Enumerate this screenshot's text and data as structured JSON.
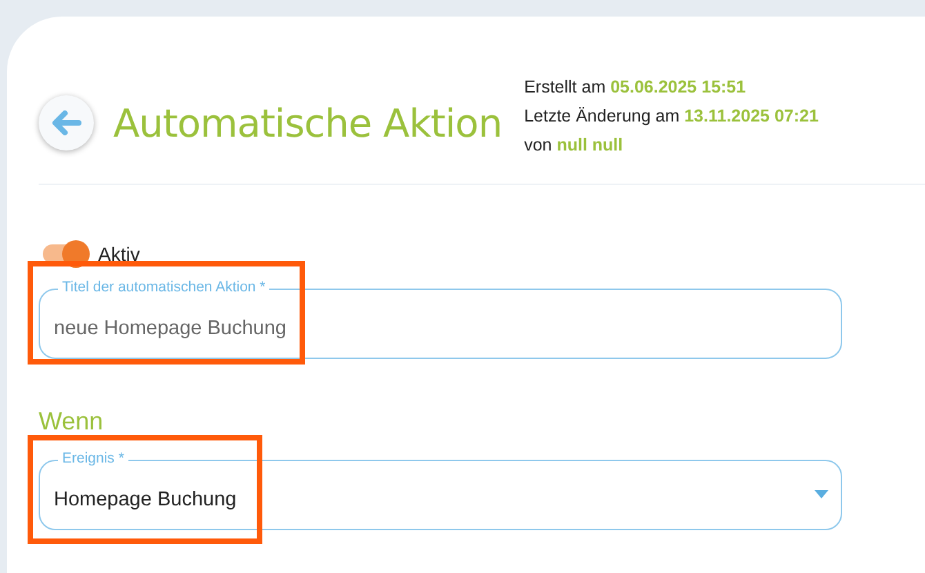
{
  "header": {
    "title": "Automatische Aktion",
    "meta": [
      {
        "label": "Erstellt am",
        "value": "05.06.2025 15:51"
      },
      {
        "label": "Letzte Änderung am",
        "value": "13.11.2025 07:21"
      },
      {
        "label": "von",
        "value": "null null"
      }
    ]
  },
  "active_toggle": {
    "label": "Aktiv",
    "on": true
  },
  "title_field": {
    "label": "Titel der automatischen Aktion *",
    "value": "neue Homepage Buchung",
    "highlighted": true
  },
  "section": {
    "heading": "Wenn"
  },
  "event_select": {
    "label": "Ereignis *",
    "value": "Homepage Buchung",
    "highlighted": true
  }
}
